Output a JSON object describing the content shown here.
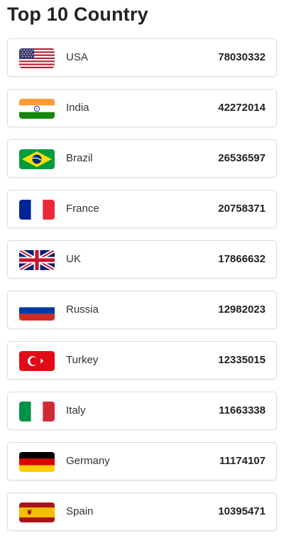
{
  "page": {
    "title": "Top 10 Country"
  },
  "countries": [
    {
      "name": "USA",
      "value": "78030332",
      "flag_icon": "usa-flag-icon"
    },
    {
      "name": "India",
      "value": "42272014",
      "flag_icon": "india-flag-icon"
    },
    {
      "name": "Brazil",
      "value": "26536597",
      "flag_icon": "brazil-flag-icon"
    },
    {
      "name": "France",
      "value": "20758371",
      "flag_icon": "france-flag-icon"
    },
    {
      "name": "UK",
      "value": "17866632",
      "flag_icon": "uk-flag-icon"
    },
    {
      "name": "Russia",
      "value": "12982023",
      "flag_icon": "russia-flag-icon"
    },
    {
      "name": "Turkey",
      "value": "12335015",
      "flag_icon": "turkey-flag-icon"
    },
    {
      "name": "Italy",
      "value": "11663338",
      "flag_icon": "italy-flag-icon"
    },
    {
      "name": "Germany",
      "value": "11174107",
      "flag_icon": "germany-flag-icon"
    },
    {
      "name": "Spain",
      "value": "10395471",
      "flag_icon": "spain-flag-icon"
    }
  ]
}
